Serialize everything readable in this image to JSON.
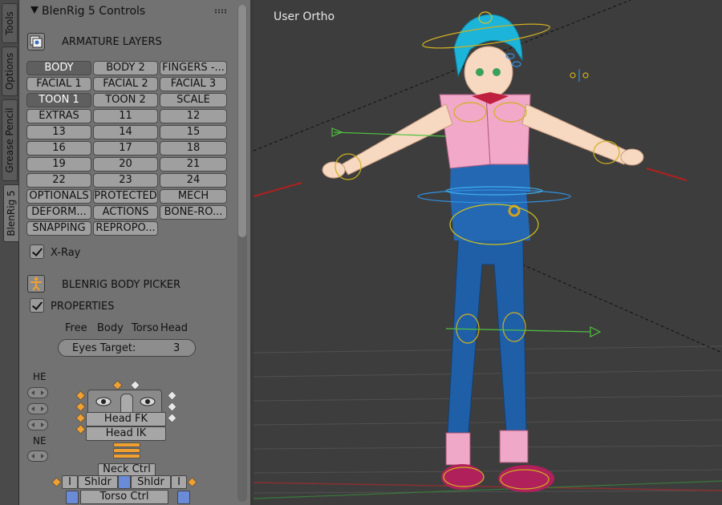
{
  "tabs": [
    "Tools",
    "Options",
    "Grease Pencil",
    "BlenRig 5"
  ],
  "panel": {
    "title": "BlenRig 5 Controls",
    "armature_layers_label": "ARMATURE LAYERS",
    "layer_buttons": [
      "BODY",
      "BODY 2",
      "FINGERS -...",
      "FACIAL 1",
      "FACIAL 2",
      "FACIAL 3",
      "TOON 1",
      "TOON 2",
      "SCALE",
      "EXTRAS",
      "11",
      "12",
      "13",
      "14",
      "15",
      "16",
      "17",
      "18",
      "19",
      "20",
      "21",
      "22",
      "23",
      "24",
      "OPTIONALS",
      "PROTECTED",
      "MECH",
      "DEFORM...",
      "ACTIONS",
      "BONE-RO...",
      "SNAPPING",
      "REPROPO..."
    ],
    "active_layers": [
      "BODY",
      "TOON 1"
    ],
    "xray_label": "X-Ray",
    "xray_checked": true,
    "body_picker_label": "BLENRIG BODY PICKER",
    "properties_label": "PROPERTIES",
    "properties_checked": true,
    "picker_tabs": [
      "Free",
      "Body",
      "Torso",
      "Head"
    ],
    "eyes_target_label": "Eyes Target:",
    "eyes_target_value": "3",
    "he_label": "HE",
    "ne_label": "NE",
    "head_fk": "Head FK",
    "head_ik": "Head IK",
    "neck_ctrl": "Neck Ctrl",
    "shldr_left": "Shldr",
    "shldr_right": "Shldr",
    "torso_ctrl": "Torso Ctrl",
    "i_left": "I",
    "i_right": "I"
  },
  "viewport": {
    "label": "User Ortho"
  }
}
